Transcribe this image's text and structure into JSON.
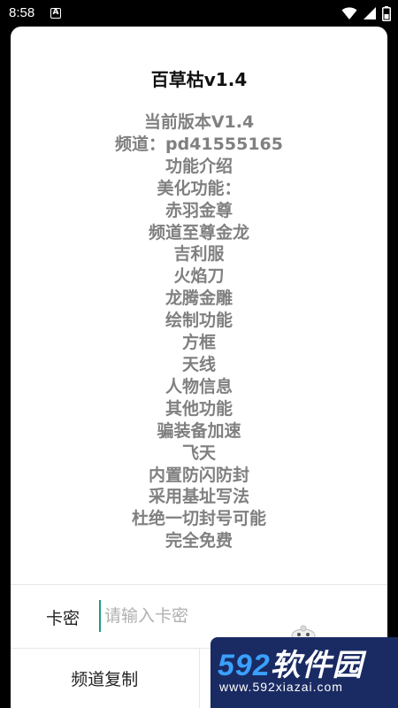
{
  "status_bar": {
    "time": "8:58",
    "app_icon_letter": "A",
    "icons": [
      "wifi-icon",
      "signal-icon",
      "battery-icon"
    ],
    "text_color": "#ffffff",
    "background": "#000000"
  },
  "dialog": {
    "title": "百草枯v1.4",
    "content_lines": [
      "当前版本V1.4",
      "频道：pd41555165",
      "功能介绍",
      "美化功能：",
      "赤羽金尊",
      "频道至尊金龙",
      "吉利服",
      "火焰刀",
      "龙腾金雕",
      "绘制功能",
      "方框",
      "天线",
      "人物信息",
      "其他功能",
      "骗装备加速",
      "飞天",
      "内置防闪防封",
      "采用基址写法",
      "杜绝一切封号可能",
      "完全免费"
    ],
    "content_color": "#808080",
    "key_label": "卡密",
    "key_input": {
      "value": "",
      "placeholder": "请输入卡密"
    },
    "buttons": {
      "copy_channel": "频道复制",
      "confirm": ""
    },
    "accent": "#1b9a8a"
  },
  "watermark": {
    "digits": "592",
    "brand": "软件园",
    "url": "www.592xiazai.com",
    "background": "#1a2b63",
    "digit_color": "#3aa0ff"
  }
}
